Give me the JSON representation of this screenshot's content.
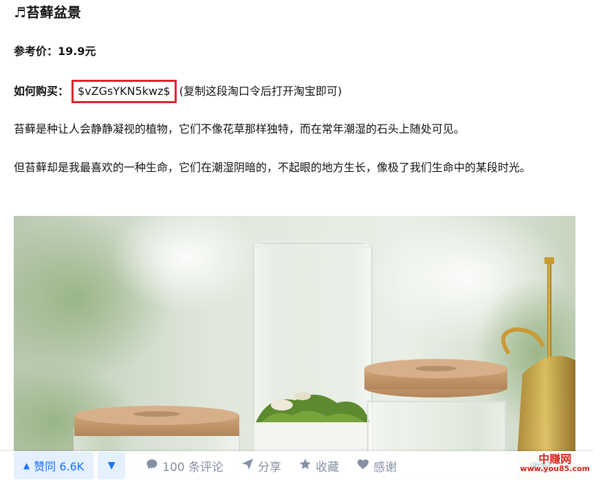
{
  "article": {
    "title": "♬苔藓盆景",
    "price_label": "参考价：",
    "price_value": "19.9元",
    "buy_label": "如何购买：",
    "code": "$vZGsYKN5kwz$",
    "code_hint": "(复制这段淘口令后打开淘宝即可)",
    "paragraph_1": "苔藓是种让人会静静凝视的植物，它们不像花草那样独特，而在常年潮湿的石头上随处可见。",
    "paragraph_2": "但苔藓却是我最喜欢的一种生命，它们在潮湿阴暗的，不起眼的地方生长，像极了我们生命中的某段时光。"
  },
  "actions": {
    "upvote_label": "赞同 6.6K",
    "comments_label": "100 条评论",
    "share_label": "分享",
    "favorite_label": "收藏",
    "thanks_label": "感谢",
    "collapse_label": "收起"
  },
  "watermark": {
    "line1": "中赚网",
    "line2": "www.you85.com"
  },
  "colors": {
    "accent": "#1772f6",
    "code_border": "#d9262c",
    "muted": "#8590a6"
  }
}
